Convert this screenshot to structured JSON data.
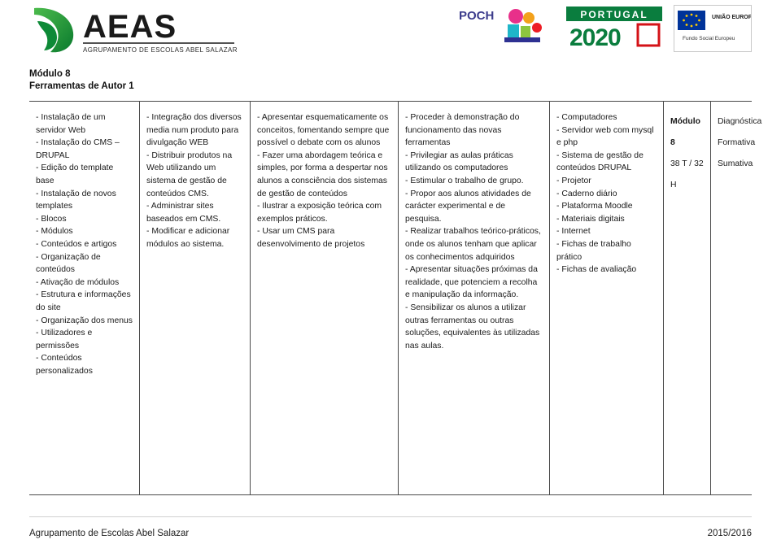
{
  "header": {
    "logo_aeas_name": "aeas-logo",
    "logo_aeas_text": "AEAS",
    "logo_aeas_subtext": "AGRUPAMENTO DE ESCOLAS ABEL SALAZAR",
    "logo_poch_text": "POCH",
    "logo_portugal_top": "PORTUGAL",
    "logo_portugal_year": "2020",
    "logo_eu_title": "UNIÃO EUROPEIA",
    "logo_eu_sub": "Fundo Social Europeu"
  },
  "module": {
    "title": "Módulo 8",
    "subtitle": "Ferramentas de Autor 1"
  },
  "table": {
    "columns": [
      {
        "name": "conteudos",
        "lines": [
          "- Instalação de um servidor Web",
          "- Instalação do CMS – DRUPAL",
          "- Edição do template base",
          "- Instalação de novos templates",
          "- Blocos",
          "- Módulos",
          "- Conteúdos e artigos",
          "- Organização de conteúdos",
          "- Ativação de módulos",
          "- Estrutura e informações do site",
          "- Organização dos menus",
          "- Utilizadores e permissões",
          "- Conteúdos personalizados"
        ]
      },
      {
        "name": "objetivos",
        "lines": [
          "- Integração dos diversos media num produto para divulgação WEB",
          "- Distribuir produtos na Web utilizando um sistema de gestão de conteúdos CMS.",
          "- Administrar sites baseados em CMS.",
          "- Modificar e adicionar módulos ao sistema."
        ]
      },
      {
        "name": "estrategias",
        "lines": [
          "- Apresentar esquematicamente os conceitos, fomentando sempre que possível o debate com os alunos",
          "- Fazer uma abordagem teórica e simples, por forma a despertar nos alunos a consciência dos sistemas de gestão de conteúdos",
          "- Ilustrar a exposição teórica com exemplos práticos.",
          "- Usar um CMS para desenvolvimento de projetos"
        ]
      },
      {
        "name": "atividades",
        "lines": [
          "- Proceder à demonstração do funcionamento das novas ferramentas",
          "- Privilegiar as aulas práticas utilizando os computadores",
          "- Estimular o trabalho de grupo.",
          "- Propor aos alunos atividades de carácter experimental e de pesquisa.",
          "- Realizar trabalhos teórico-práticos, onde os alunos tenham que aplicar os conhecimentos adquiridos",
          "- Apresentar situações próximas da realidade, que potenciem a recolha e manipulação da informação.",
          "- Sensibilizar os alunos a utilizar outras ferramentas ou outras soluções, equivalentes às utilizadas nas aulas."
        ]
      },
      {
        "name": "recursos",
        "lines": [
          "- Computadores",
          "- Servidor web com mysql e php",
          "- Sistema de gestão de conteúdos DRUPAL",
          "- Projetor",
          "- Caderno diário",
          "- Plataforma Moodle",
          "- Materiais digitais",
          "- Internet",
          "- Fichas de trabalho prático",
          "- Fichas de avaliação"
        ]
      },
      {
        "name": "carga-horaria",
        "lines": [
          "Módulo 8",
          "38 T / 32 H"
        ]
      },
      {
        "name": "avaliacao",
        "lines": [
          "Diagnóstica",
          "Formativa",
          "Sumativa"
        ]
      }
    ]
  },
  "footer": {
    "left": "Agrupamento de Escolas Abel Salazar",
    "right": "2015/2016"
  }
}
